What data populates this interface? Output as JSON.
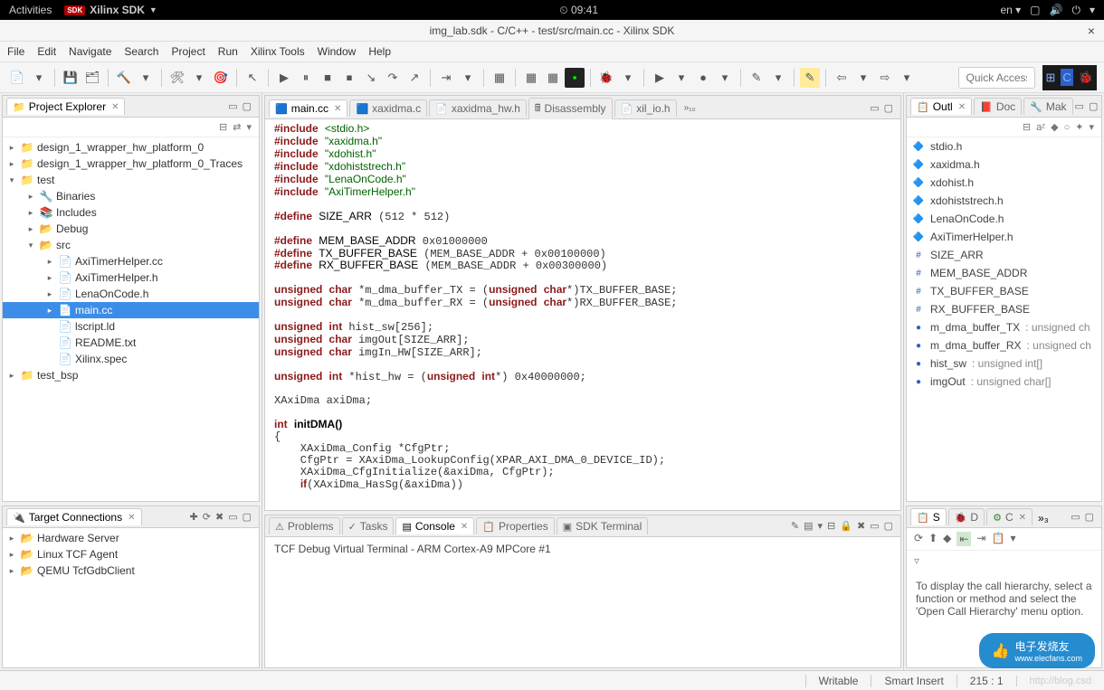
{
  "os_bar": {
    "activities": "Activities",
    "app_name": "Xilinx SDK",
    "time": "09:41",
    "lang": "en"
  },
  "window": {
    "title": "img_lab.sdk - C/C++ - test/src/main.cc - Xilinx SDK"
  },
  "menu": [
    "File",
    "Edit",
    "Navigate",
    "Search",
    "Project",
    "Run",
    "Xilinx Tools",
    "Window",
    "Help"
  ],
  "toolbar": {
    "quick_access": "Quick Access"
  },
  "project_explorer": {
    "title": "Project Explorer",
    "items": [
      {
        "depth": 0,
        "arrow": "▸",
        "icon": "📁",
        "label": "design_1_wrapper_hw_platform_0"
      },
      {
        "depth": 0,
        "arrow": "▸",
        "icon": "📁",
        "label": "design_1_wrapper_hw_platform_0_Traces"
      },
      {
        "depth": 0,
        "arrow": "▾",
        "icon": "📁",
        "label": "test"
      },
      {
        "depth": 1,
        "arrow": "▸",
        "icon": "🔧",
        "label": "Binaries"
      },
      {
        "depth": 1,
        "arrow": "▸",
        "icon": "📚",
        "label": "Includes"
      },
      {
        "depth": 1,
        "arrow": "▸",
        "icon": "📂",
        "label": "Debug"
      },
      {
        "depth": 1,
        "arrow": "▾",
        "icon": "📂",
        "label": "src"
      },
      {
        "depth": 2,
        "arrow": "▸",
        "icon": "📄",
        "label": "AxiTimerHelper.cc"
      },
      {
        "depth": 2,
        "arrow": "▸",
        "icon": "📄",
        "label": "AxiTimerHelper.h"
      },
      {
        "depth": 2,
        "arrow": "▸",
        "icon": "📄",
        "label": "LenaOnCode.h"
      },
      {
        "depth": 2,
        "arrow": "▸",
        "icon": "📄",
        "label": "main.cc",
        "selected": true
      },
      {
        "depth": 2,
        "arrow": "",
        "icon": "📄",
        "label": "lscript.ld"
      },
      {
        "depth": 2,
        "arrow": "",
        "icon": "📄",
        "label": "README.txt"
      },
      {
        "depth": 2,
        "arrow": "",
        "icon": "📄",
        "label": "Xilinx.spec"
      },
      {
        "depth": 0,
        "arrow": "▸",
        "icon": "📁",
        "label": "test_bsp"
      }
    ]
  },
  "target_connections": {
    "title": "Target Connections",
    "items": [
      {
        "depth": 0,
        "arrow": "▸",
        "icon": "📂",
        "label": "Hardware Server"
      },
      {
        "depth": 0,
        "arrow": "▸",
        "icon": "📂",
        "label": "Linux TCF Agent"
      },
      {
        "depth": 0,
        "arrow": "▸",
        "icon": "📂",
        "label": "QEMU TcfGdbClient"
      }
    ]
  },
  "editor": {
    "tabs": [
      {
        "label": "main.cc",
        "active": true
      },
      {
        "label": "xaxidma.c"
      },
      {
        "label": "xaxidma_hw.h"
      },
      {
        "label": "Disassembly"
      },
      {
        "label": "xil_io.h"
      }
    ],
    "overflow": "»₁₀",
    "lines": [
      {
        "type": "include",
        "lib": "<stdio.h>"
      },
      {
        "type": "include",
        "lib": "\"xaxidma.h\""
      },
      {
        "type": "include",
        "lib": "\"xdohist.h\""
      },
      {
        "type": "include",
        "lib": "\"xdohiststrech.h\""
      },
      {
        "type": "include",
        "lib": "\"LenaOnCode.h\""
      },
      {
        "type": "include",
        "lib": "\"AxiTimerHelper.h\""
      },
      {
        "type": "blank"
      },
      {
        "type": "define",
        "name": "SIZE_ARR",
        "val": "(512 * 512)"
      },
      {
        "type": "blank"
      },
      {
        "type": "define",
        "name": "MEM_BASE_ADDR",
        "val": "0x01000000"
      },
      {
        "type": "define",
        "name": "TX_BUFFER_BASE",
        "val": "(MEM_BASE_ADDR + 0x00100000)"
      },
      {
        "type": "define",
        "name": "RX_BUFFER_BASE",
        "val": "(MEM_BASE_ADDR + 0x00300000)"
      },
      {
        "type": "blank"
      },
      {
        "type": "decl",
        "text": "unsigned char *m_dma_buffer_TX = (unsigned char*)TX_BUFFER_BASE;"
      },
      {
        "type": "decl",
        "text": "unsigned char *m_dma_buffer_RX = (unsigned char*)RX_BUFFER_BASE;"
      },
      {
        "type": "blank"
      },
      {
        "type": "decl",
        "text": "unsigned int hist_sw[256];"
      },
      {
        "type": "decl",
        "text": "unsigned char imgOut[SIZE_ARR];"
      },
      {
        "type": "decl",
        "text": "unsigned char imgIn_HW[SIZE_ARR];"
      },
      {
        "type": "blank"
      },
      {
        "type": "decl",
        "text": "unsigned int *hist_hw = (unsigned int*) 0x40000000;"
      },
      {
        "type": "blank"
      },
      {
        "type": "plain",
        "text": "XAxiDma axiDma;"
      },
      {
        "type": "blank"
      },
      {
        "type": "func",
        "sig": "int initDMA()"
      },
      {
        "type": "plain",
        "text": "{"
      },
      {
        "type": "plain",
        "text": "    XAxiDma_Config *CfgPtr;"
      },
      {
        "type": "plain",
        "text": "    CfgPtr = XAxiDma_LookupConfig(XPAR_AXI_DMA_0_DEVICE_ID);"
      },
      {
        "type": "plain",
        "text": "    XAxiDma_CfgInitialize(&axiDma, CfgPtr);"
      },
      {
        "type": "if",
        "text": "    if(XAxiDma_HasSg(&axiDma))"
      }
    ]
  },
  "bottom": {
    "tabs": [
      "Problems",
      "Tasks",
      "Console",
      "Properties",
      "SDK Terminal"
    ],
    "active_tab": 2,
    "console_header": "TCF Debug Virtual Terminal - ARM Cortex-A9 MPCore #1"
  },
  "outline": {
    "tabs": [
      "Outl",
      "Doc",
      "Mak"
    ],
    "items": [
      {
        "icon": "🔷",
        "label": "stdio.h"
      },
      {
        "icon": "🔷",
        "label": "xaxidma.h"
      },
      {
        "icon": "🔷",
        "label": "xdohist.h"
      },
      {
        "icon": "🔷",
        "label": "xdohiststrech.h"
      },
      {
        "icon": "🔷",
        "label": "LenaOnCode.h"
      },
      {
        "icon": "🔷",
        "label": "AxiTimerHelper.h"
      },
      {
        "icon": "#",
        "label": "SIZE_ARR"
      },
      {
        "icon": "#",
        "label": "MEM_BASE_ADDR"
      },
      {
        "icon": "#",
        "label": "TX_BUFFER_BASE"
      },
      {
        "icon": "#",
        "label": "RX_BUFFER_BASE"
      },
      {
        "icon": "●",
        "label": "m_dma_buffer_TX",
        "suffix": " : unsigned ch"
      },
      {
        "icon": "●",
        "label": "m_dma_buffer_RX",
        "suffix": " : unsigned ch"
      },
      {
        "icon": "●",
        "label": "hist_sw",
        "suffix": " : unsigned int[]"
      },
      {
        "icon": "●",
        "label": "imgOut",
        "suffix": " : unsigned char[]"
      }
    ]
  },
  "call_hierarchy": {
    "tabs": [
      "S",
      "D",
      "C"
    ],
    "overflow": "»₃",
    "message": "To display the call hierarchy, select a function or method and select the 'Open Call Hierarchy' menu option."
  },
  "status": {
    "writable": "Writable",
    "insert": "Smart Insert",
    "pos": "215 : 1",
    "watermark": "http://blog.csd",
    "brand": "电子发烧友",
    "brand_url": "www.elecfans.com"
  }
}
